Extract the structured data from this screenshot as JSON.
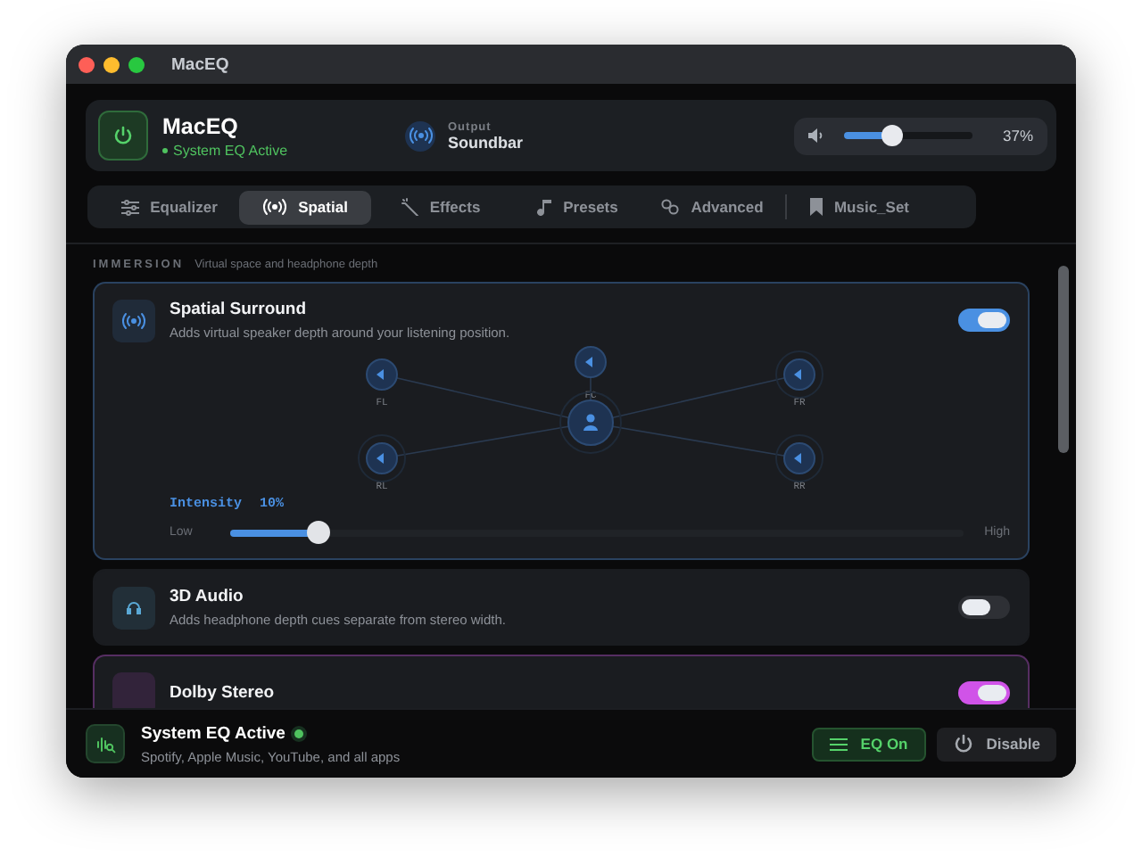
{
  "window": {
    "title": "MacEQ"
  },
  "header": {
    "app_name": "MacEQ",
    "status": "System EQ Active",
    "output_label": "Output",
    "output_device": "Soundbar",
    "volume": {
      "level": 0.37,
      "reading": "37%"
    }
  },
  "tabs": [
    {
      "label": "Equalizer",
      "kind": "tab",
      "selected": false
    },
    {
      "label": "Spatial",
      "kind": "tab",
      "selected": true
    },
    {
      "label": "Effects",
      "kind": "tab",
      "selected": false
    },
    {
      "label": "Presets",
      "kind": "tab",
      "selected": false
    },
    {
      "label": "Advanced",
      "kind": "tab",
      "selected": false
    },
    {
      "label": "Music_Set",
      "kind": "bookmark",
      "selected": false
    }
  ],
  "section": {
    "title": "IMMERSION",
    "subtitle": "Virtual space and headphone depth"
  },
  "features": [
    {
      "kind": "spatial",
      "title": "Spatial Surround",
      "description": "Adds virtual speaker depth around your listening position.",
      "on": true,
      "color": "#4a90e2",
      "speakers": [
        {
          "label": "FL"
        },
        {
          "label": "FC"
        },
        {
          "label": "FR"
        },
        {
          "label": "RL"
        },
        {
          "label": "RR"
        }
      ],
      "intensity": {
        "label": "Intensity",
        "reading": "10%",
        "low": "Low",
        "high": "High",
        "level": 0.12
      }
    },
    {
      "kind": "plain",
      "title": "3D Audio",
      "description": "Adds headphone depth cues separate from stereo width.",
      "on": false,
      "color": "#5aa9d6"
    },
    {
      "kind": "plain",
      "title": "Dolby Stereo",
      "on": true,
      "color": "#d053e8"
    }
  ],
  "footer": {
    "title": "System EQ Active",
    "subtitle": "Spotify, Apple Music, YouTube, and all apps",
    "buttons": [
      {
        "label": "EQ On",
        "kind": "eq"
      },
      {
        "label": "Disable",
        "kind": "power"
      }
    ]
  }
}
